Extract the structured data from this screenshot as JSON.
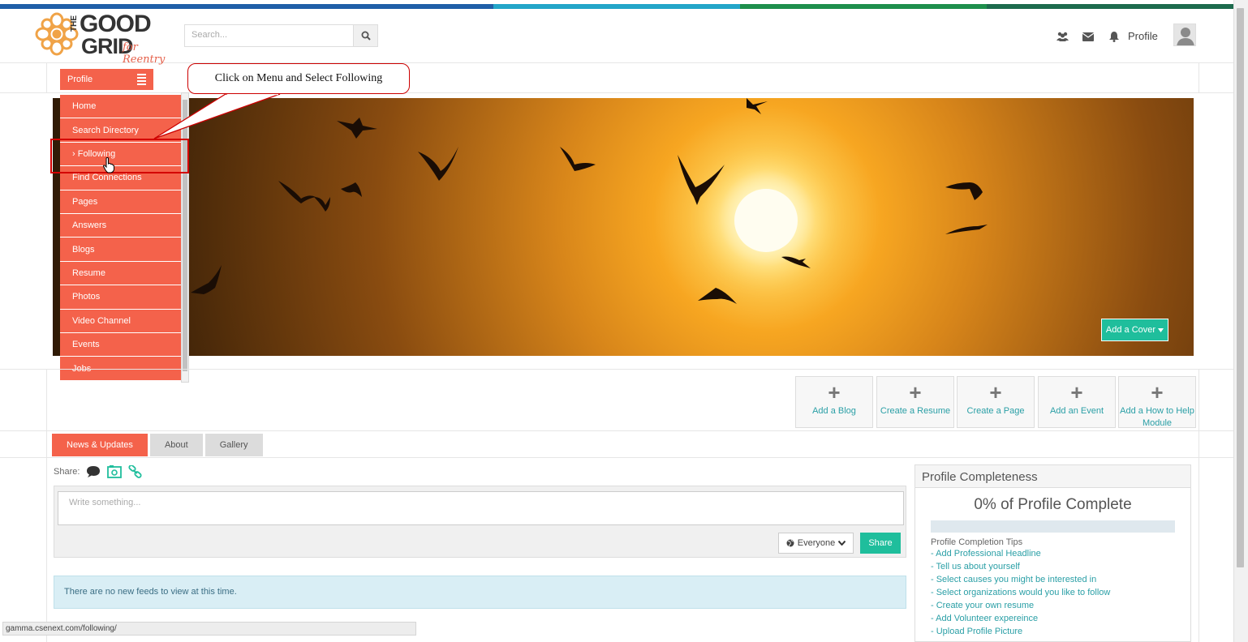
{
  "header": {
    "logo": {
      "the": "THE",
      "good": "GOOD",
      "grid": "GRID",
      "reentry": "for Reentry"
    },
    "search_placeholder": "Search...",
    "profile_label": "Profile",
    "stripe_colors": [
      "#1f5fa8",
      "#1f5fa8",
      "#23a6c9",
      "#1e8f4c",
      "#1d6b4d"
    ]
  },
  "menu": {
    "button_label": "Profile",
    "items": [
      {
        "label": "Home"
      },
      {
        "label": "Search Directory"
      },
      {
        "label": "› Following"
      },
      {
        "label": "Find Connections"
      },
      {
        "label": "Pages"
      },
      {
        "label": "Answers"
      },
      {
        "label": "Blogs"
      },
      {
        "label": "Resume"
      },
      {
        "label": "Photos"
      },
      {
        "label": "Video Channel"
      },
      {
        "label": "Events"
      },
      {
        "label": "Jobs"
      }
    ]
  },
  "annotation": {
    "callout_text": "Click on Menu and Select Following"
  },
  "cover": {
    "add_cover_label": "Add a Cover"
  },
  "actions": [
    {
      "label": "Add a Blog"
    },
    {
      "label": "Create a Resume"
    },
    {
      "label": "Create a Page"
    },
    {
      "label": "Add an Event"
    },
    {
      "label": "Add a How to Help Module"
    }
  ],
  "tabs": [
    {
      "label": "News & Updates"
    },
    {
      "label": "About"
    },
    {
      "label": "Gallery"
    }
  ],
  "composer": {
    "share_label": "Share:",
    "placeholder": "Write something...",
    "audience": "Everyone",
    "share_button": "Share"
  },
  "feed": {
    "empty_message": "There are no new feeds to view at this time."
  },
  "completeness": {
    "title": "Profile Completeness",
    "percent_label": "0% of Profile Complete",
    "percent": 0,
    "tips_title": "Profile Completion Tips",
    "tips": [
      "- Add Professional Headline",
      "- Tell us about yourself",
      "- Select causes you might be interested in",
      "- Select organizations would you like to follow",
      "- Create your own resume",
      "- Add Volunteer expereince",
      "- Upload Profile Picture"
    ]
  },
  "status_url": "gamma.csenext.com/following/",
  "colors": {
    "accent": "#f4624b",
    "teal": "#1fbe9c",
    "link": "#2a9fa6"
  }
}
